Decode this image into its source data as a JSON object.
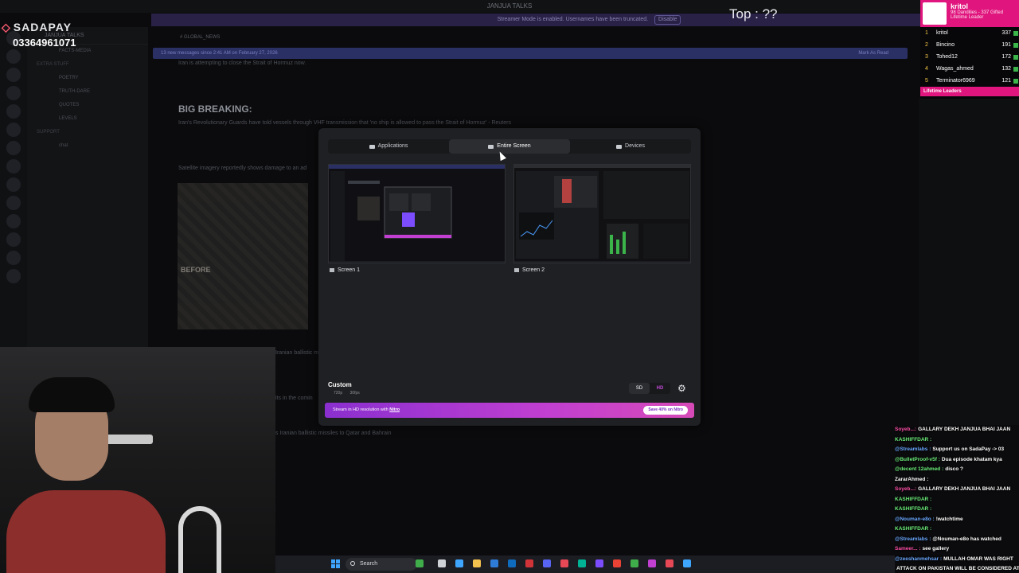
{
  "discord": {
    "window_title": "JANJUA TALKS",
    "streamer_notice": "Streamer Mode is enabled. Usernames have been truncated.",
    "disable_label": "Disable",
    "server_name": "JANJUA TALKS",
    "channel_name": "GLOBAL_NEWS",
    "new_messages_text": "13 new messages since 2:41 AM on February 27, 2026",
    "mark_as_read": "Mark As Read",
    "messages": {
      "line1": "Iran is attempting to close the Strait of Hormuz now.",
      "heading": "BIG BREAKING:",
      "line2": "Iran's Revolutionary Guards have told vessels through VHF transmission that 'no ship is allowed to pass the Strait of Hormuz' - Reuters",
      "line3": "Satellite imagery reportedly shows damage to an ad",
      "line4": "Iranian ballistic mi",
      "line5": "its in the comin",
      "line6": "s Iranian ballistic missiles to Qatar and Bahrain"
    },
    "before_label": "BEFORE",
    "channels": [
      {
        "label": "FACTS-MEDIA",
        "category": false
      },
      {
        "label": "EXTRA STUFF",
        "category": true
      },
      {
        "label": "POETRY",
        "category": false
      },
      {
        "label": "TRUTH-DARE",
        "category": false
      },
      {
        "label": "QUOTES",
        "category": false
      },
      {
        "label": "LEVELS",
        "category": false
      },
      {
        "label": "SUPPORT",
        "category": true
      },
      {
        "label": "chat",
        "category": false
      }
    ]
  },
  "overlay": {
    "sadapay_label": "SADAPAY",
    "phone": "03364961071",
    "top_label": "Top : ??"
  },
  "leaderboard": {
    "top_name": "kritol",
    "top_sub": "98 Dandilies - 337 Gifted",
    "top_sub2": "Lifetime Leader",
    "rows": [
      {
        "rank": "1",
        "name": "kritol",
        "score": "337"
      },
      {
        "rank": "2",
        "name": "Bincino",
        "score": "191"
      },
      {
        "rank": "3",
        "name": "Tohed12",
        "score": "172"
      },
      {
        "rank": "4",
        "name": "Wagas_ahmed",
        "score": "132"
      },
      {
        "rank": "5",
        "name": "Terminator6969",
        "score": "121"
      }
    ],
    "footer": "Lifetime Leaders"
  },
  "dialog": {
    "tabs": {
      "applications": "Applications",
      "entire_screen": "Entire Screen",
      "devices": "Devices"
    },
    "screens": {
      "screen1": "Screen 1",
      "screen2": "Screen 2"
    },
    "quality": {
      "title": "Custom",
      "resolution": "720p",
      "fps": "30fps",
      "sd": "SD",
      "hd": "HD"
    },
    "nitro": {
      "text": "Stream in HD resolution with",
      "link": "Nitro",
      "save": "Save 40% on Nitro"
    }
  },
  "chat": [
    {
      "user": "Soyeb...:",
      "msg": "GALLARY DEKH JANJUA BHAI JAAN",
      "color": "#ff4fa8"
    },
    {
      "user": "KASHIFFDAR :",
      "msg": "",
      "color": "#6cf07a"
    },
    {
      "user": "@Streamlabs :",
      "msg": "Support us on SadaPay -> 03",
      "color": "#6aa8ff"
    },
    {
      "user": "@BulletProof-v5f :",
      "msg": "Dua episode khatam kya",
      "color": "#6cf07a"
    },
    {
      "user": "@decent 12ahmed :",
      "msg": "disco ?",
      "color": "#6cf07a"
    },
    {
      "user": "ZararAhmed :",
      "msg": "",
      "color": "#ffffff"
    },
    {
      "user": "Soyeb...:",
      "msg": "GALLARY DEKH JANJUA BHAI JAAN",
      "color": "#ff4fa8"
    },
    {
      "user": "KASHIFFDAR :",
      "msg": "",
      "color": "#6cf07a"
    },
    {
      "user": "KASHIFFDAR :",
      "msg": "",
      "color": "#6cf07a"
    },
    {
      "user": "@Nouman-e8o :",
      "msg": "!watchtime",
      "color": "#6aa8ff"
    },
    {
      "user": "KASHIFFDAR :",
      "msg": "",
      "color": "#6cf07a"
    },
    {
      "user": "@Streamlabs :",
      "msg": "@Nouman-e8o has watched",
      "color": "#6aa8ff"
    },
    {
      "user": "Sameer... :",
      "msg": "see gallery",
      "color": "#ff4fa8"
    },
    {
      "user": "@zeeshanmehsar :",
      "msg": "MULLAH OMAR WAS RIGHT",
      "color": "#6aa8ff"
    },
    {
      "user": "",
      "msg": "ATTACK ON PAKISTAN WILL BE CONSIDERED AT",
      "color": "#ffffff"
    }
  ],
  "taskbar": {
    "search": "Search"
  }
}
